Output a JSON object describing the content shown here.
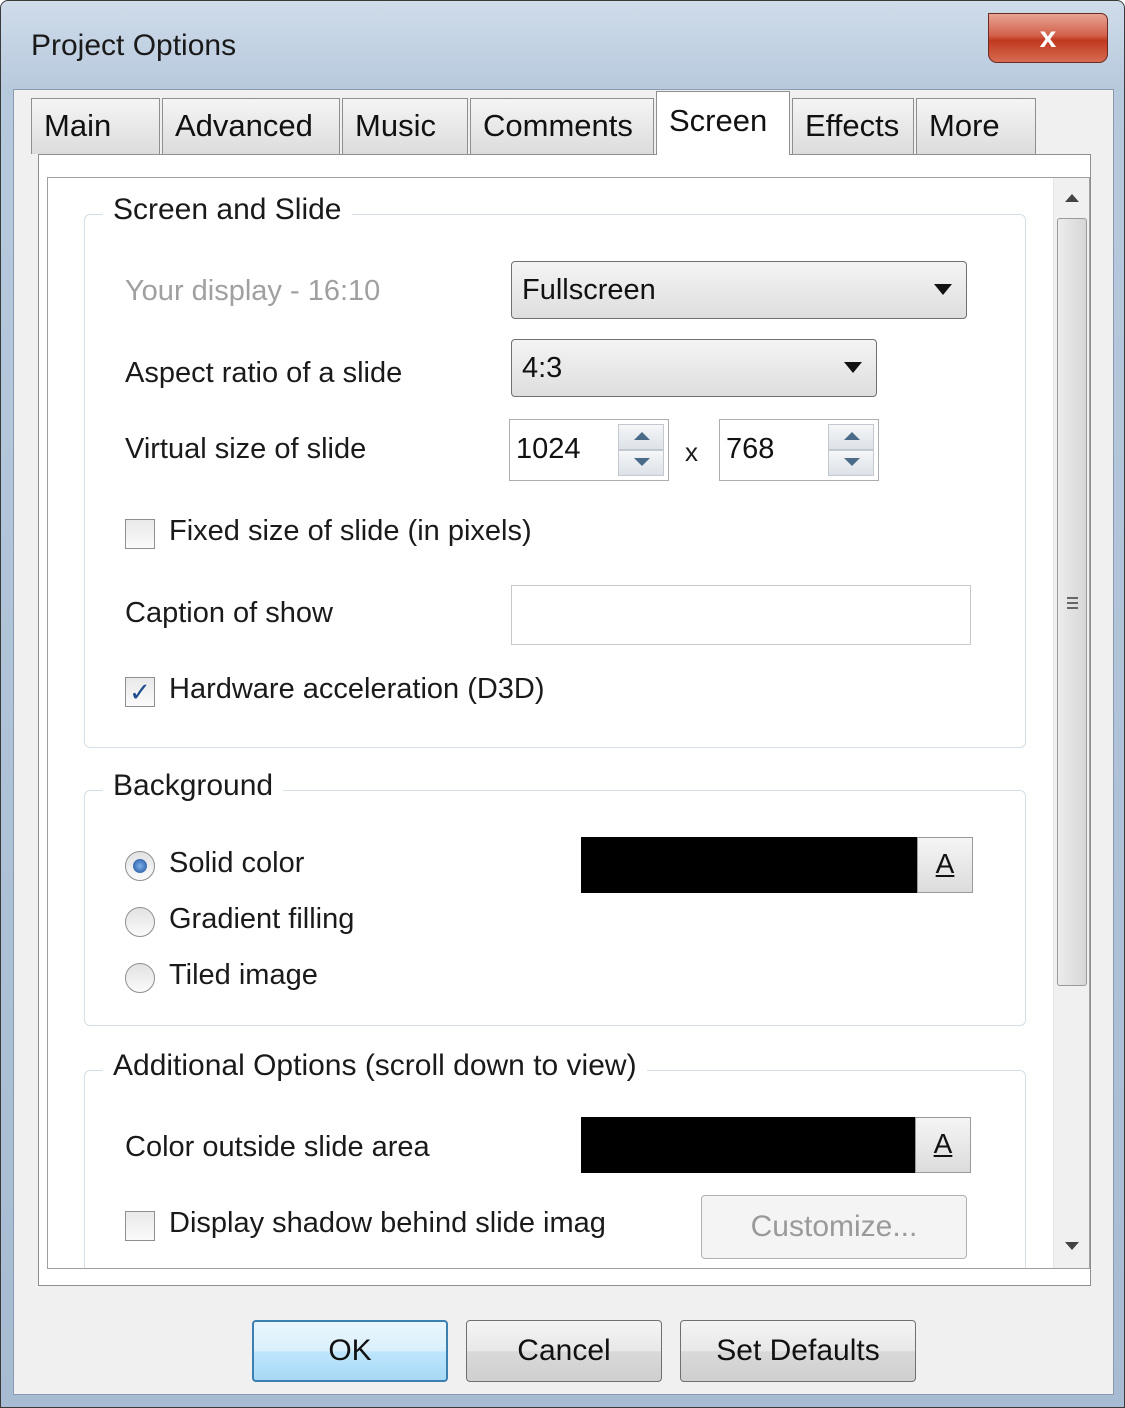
{
  "window": {
    "title": "Project Options",
    "close_label": "x"
  },
  "tabs": [
    {
      "label": "Main"
    },
    {
      "label": "Advanced"
    },
    {
      "label": "Music"
    },
    {
      "label": "Comments"
    },
    {
      "label": "Screen"
    },
    {
      "label": "Effects"
    },
    {
      "label": "More"
    }
  ],
  "screen_slide": {
    "legend": "Screen and Slide",
    "display_label": "Your display - 16:10",
    "display_value": "Fullscreen",
    "aspect_label": "Aspect ratio of a slide",
    "aspect_value": "4:3",
    "virtual_label": "Virtual size of slide",
    "width_value": "1024",
    "x_sep": "x",
    "height_value": "768",
    "fixed_label": "Fixed size of slide (in pixels)",
    "fixed_checked": false,
    "caption_label": "Caption of show",
    "caption_value": "",
    "hw_label": "Hardware acceleration (D3D)",
    "hw_checked": true
  },
  "background": {
    "legend": "Background",
    "solid_label": "Solid color",
    "gradient_label": "Gradient filling",
    "tiled_label": "Tiled image",
    "selected": "solid",
    "color": "#000000",
    "color_button_label": "A"
  },
  "additional": {
    "legend": "Additional Options (scroll down to view)",
    "outside_label": "Color outside slide area",
    "outside_color": "#000000",
    "color_button_label": "A",
    "shadow_label": "Display shadow behind slide imag",
    "shadow_checked": false,
    "customize_label": "Customize..."
  },
  "footer": {
    "ok_label": "OK",
    "cancel_label": "Cancel",
    "defaults_label": "Set Defaults"
  }
}
